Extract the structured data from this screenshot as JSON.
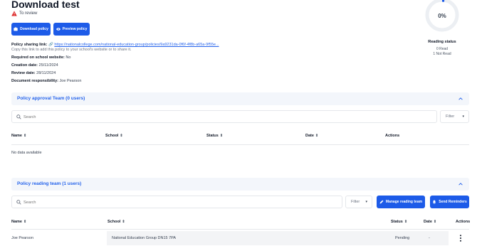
{
  "page": {
    "title": "Download test",
    "status": "To review"
  },
  "actions": {
    "download_label": "Download policy",
    "preview_label": "Preview policy"
  },
  "details": {
    "sharing_label": "Policy sharing link:",
    "sharing_url": "https://nationalcollege.com/national-education-group/policies/9a9231da-0f6f-4f8b-a65a-9f55e...",
    "sharing_hint": "Copy this link to add this policy to your school's website or to share it.",
    "website_label": "Required on school website:",
    "website_value": "No",
    "creation_label": "Creation date:",
    "creation_value": "25/11/2024",
    "review_label": "Review date:",
    "review_value": "28/11/2024",
    "responsibility_label": "Document responsibility:",
    "responsibility_value": "Joe Pearson"
  },
  "reading_status": {
    "percent": "0%",
    "progress": 0,
    "title": "Reading status",
    "read": "0 Read",
    "not_read": "1 Not Read"
  },
  "approval": {
    "title": "Policy approval Team (0 users)",
    "search_placeholder": "Search",
    "filter_label": "Filter",
    "columns": [
      "Name",
      "School",
      "Status",
      "Date",
      "Actions"
    ],
    "empty_text": "No data available"
  },
  "reading": {
    "title": "Policy reading team (1 users)",
    "search_placeholder": "Search",
    "filter_label": "Filter",
    "manage_label": "Manage reading team",
    "reminders_label": "Send Reminders",
    "columns": [
      "Name",
      "School",
      "Status",
      "Date",
      "Actions"
    ],
    "rows": [
      {
        "name": "Joe Pearson",
        "school": "National Education Group DN15 7PA",
        "status": "Pending",
        "date": "-"
      }
    ]
  },
  "colors": {
    "accent": "#1d5be8",
    "warning": "#dc2626",
    "section_bg": "#f3f6fb",
    "link": "#2563eb"
  }
}
